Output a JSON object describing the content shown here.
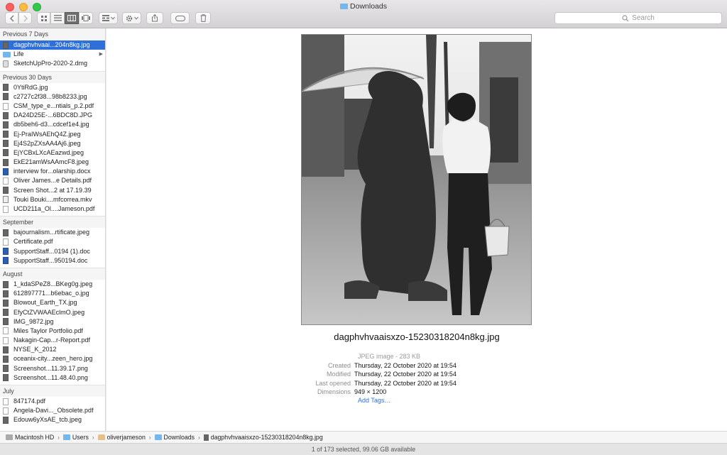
{
  "window": {
    "title": "Downloads"
  },
  "toolbar": {
    "search_placeholder": "Search"
  },
  "sidebar": {
    "sections": [
      {
        "header": "Previous 7 Days",
        "items": [
          {
            "name": "dagphvhvaai...204n8kg.jpg",
            "kind": "img",
            "selected": true
          },
          {
            "name": "Life",
            "kind": "folder",
            "arrow": true
          },
          {
            "name": "SketchUpPro-2020-2.dmg",
            "kind": "dmg"
          }
        ]
      },
      {
        "header": "Previous 30 Days",
        "items": [
          {
            "name": "0YtiRdG.jpg",
            "kind": "img"
          },
          {
            "name": "c2727c2f38...98b8233.jpg",
            "kind": "img"
          },
          {
            "name": "CSM_type_e...ntials_p.2.pdf",
            "kind": "pdf"
          },
          {
            "name": "DA24D25E-...6BDC8D.JPG",
            "kind": "img"
          },
          {
            "name": "db5beh6-d3...cdcef1e4.jpg",
            "kind": "img"
          },
          {
            "name": "Ej-PraIWsAEhQ4Z.jpeg",
            "kind": "img"
          },
          {
            "name": "Ej4S2pZXsAA4Aj6.jpeg",
            "kind": "img"
          },
          {
            "name": "EjYCBxLXcAEazwd.jpeg",
            "kind": "img"
          },
          {
            "name": "EkE21amWsAAmcF8.jpeg",
            "kind": "img"
          },
          {
            "name": "interview for...olarship.docx",
            "kind": "doc"
          },
          {
            "name": "Oliver James...e Details.pdf",
            "kind": "pdf"
          },
          {
            "name": "Screen Shot...2 at 17.19.39",
            "kind": "img"
          },
          {
            "name": "Touki Bouki....mfcorrea.mkv",
            "kind": "mkv"
          },
          {
            "name": "UCD211a_Ol....Jameson.pdf",
            "kind": "pdf"
          }
        ]
      },
      {
        "header": "September",
        "items": [
          {
            "name": "bajournalism...rtificate.jpeg",
            "kind": "img"
          },
          {
            "name": "Certificate.pdf",
            "kind": "pdf"
          },
          {
            "name": "SupportStaff...0194 (1).doc",
            "kind": "doc"
          },
          {
            "name": "SupportStaff...950194.doc",
            "kind": "doc"
          }
        ]
      },
      {
        "header": "August",
        "items": [
          {
            "name": "1_kdaSPeZ8...BKeg0g.jpeg",
            "kind": "img"
          },
          {
            "name": "612897771...b6ebac_o.jpg",
            "kind": "img"
          },
          {
            "name": "Blowout_Earth_TX.jpg",
            "kind": "img"
          },
          {
            "name": "EfyCtZVWAAEclmO.jpeg",
            "kind": "img"
          },
          {
            "name": "IMG_9872.jpg",
            "kind": "img"
          },
          {
            "name": "Miles Taylor Portfolio.pdf",
            "kind": "pdf"
          },
          {
            "name": "Nakagin-Cap...r-Report.pdf",
            "kind": "pdf"
          },
          {
            "name": "NYSE_K_2012",
            "kind": "img"
          },
          {
            "name": "oceanix-city...zeen_hero.jpg",
            "kind": "img"
          },
          {
            "name": "Screenshot...11.39.17.png",
            "kind": "img"
          },
          {
            "name": "Screenshot...11.48.40.png",
            "kind": "img"
          }
        ]
      },
      {
        "header": "July",
        "items": [
          {
            "name": "847174.pdf",
            "kind": "pdf"
          },
          {
            "name": "Angela-Davi..._Obsolete.pdf",
            "kind": "pdf"
          },
          {
            "name": "Edouw6yXsAE_tcb.jpeg",
            "kind": "img"
          }
        ]
      }
    ]
  },
  "preview": {
    "filename": "dagphvhvaaisxzo-15230318204n8kg.jpg",
    "kind": "JPEG image - 283 KB",
    "meta": [
      {
        "key": "Created",
        "value": "Thursday, 22 October 2020 at 19:54"
      },
      {
        "key": "Modified",
        "value": "Thursday, 22 October 2020 at 19:54"
      },
      {
        "key": "Last opened",
        "value": "Thursday, 22 October 2020 at 19:54"
      },
      {
        "key": "Dimensions",
        "value": "949 × 1200"
      }
    ],
    "add_tags": "Add Tags…"
  },
  "pathbar": {
    "items": [
      {
        "label": "Macintosh HD",
        "icon": "hard-drive-icon"
      },
      {
        "label": "Users",
        "icon": "folder-icon"
      },
      {
        "label": "oliverjameson",
        "icon": "home-icon"
      },
      {
        "label": "Downloads",
        "icon": "folder-icon"
      },
      {
        "label": "dagphvhvaaisxzo-15230318204n8kg.jpg",
        "icon": "image-file-icon"
      }
    ]
  },
  "status": {
    "text": "1 of 173 selected, 99.06 GB available"
  }
}
